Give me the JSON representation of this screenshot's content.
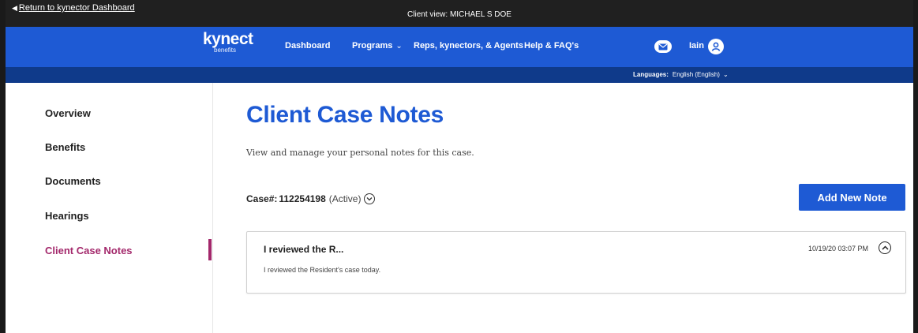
{
  "utility_bar": {
    "return_link": "Return to kynector Dashboard",
    "client_view": "Client view: MICHAEL S DOE"
  },
  "nav": {
    "logo_main": "kynect",
    "logo_sub": "benefits",
    "links": [
      {
        "label": "Dashboard"
      },
      {
        "label": "Programs"
      },
      {
        "label": "Reps, kynectors, & Agents"
      },
      {
        "label": "Help & FAQ's"
      }
    ],
    "user_name": "Iain"
  },
  "language": {
    "label": "Languages:",
    "value": "English (English)"
  },
  "sidebar": {
    "items": [
      {
        "label": "Overview"
      },
      {
        "label": "Benefits"
      },
      {
        "label": "Documents"
      },
      {
        "label": "Hearings"
      },
      {
        "label": "Client Case Notes"
      }
    ]
  },
  "main": {
    "title": "Client Case Notes",
    "subtitle": "View and manage your personal notes for this case.",
    "case_label": "Case#:",
    "case_number": "112254198",
    "case_status": "(Active)",
    "add_button": "Add New Note",
    "notes": [
      {
        "title": "I reviewed the R...",
        "body": "I reviewed the Resident's case today.",
        "date": "10/19/20 03:07 PM"
      }
    ]
  },
  "colors": {
    "brand_blue": "#1e5ad4",
    "dark_blue": "#0f3a8a",
    "active_magenta": "#a3286b",
    "utility_black": "#202020"
  }
}
